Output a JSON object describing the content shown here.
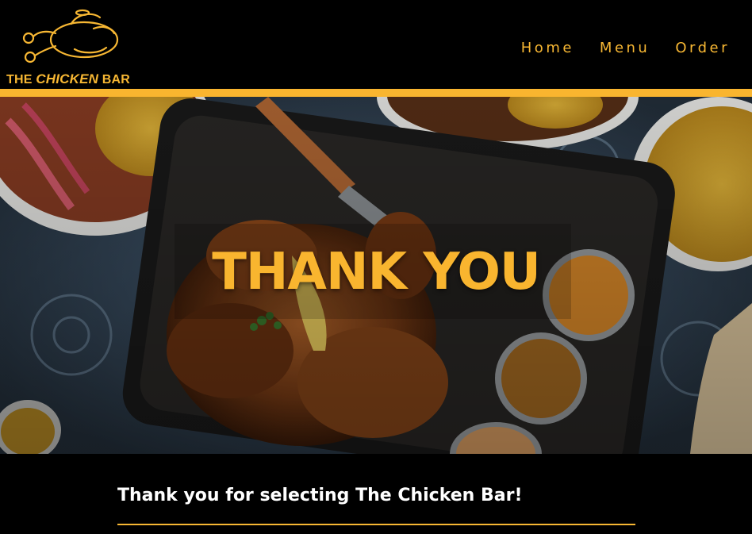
{
  "brand": {
    "logo_the": "THE",
    "logo_chicken": "CHICKEN",
    "logo_bar": "BAR",
    "color": "#f7b733"
  },
  "nav": {
    "items": [
      {
        "label": "Home"
      },
      {
        "label": "Menu"
      },
      {
        "label": "Order"
      }
    ]
  },
  "hero": {
    "title": "THANK YOU"
  },
  "content": {
    "message": "Thank you for selecting The Chicken Bar!"
  },
  "colors": {
    "accent": "#f9b52f",
    "background": "#000000",
    "text": "#ffffff"
  }
}
